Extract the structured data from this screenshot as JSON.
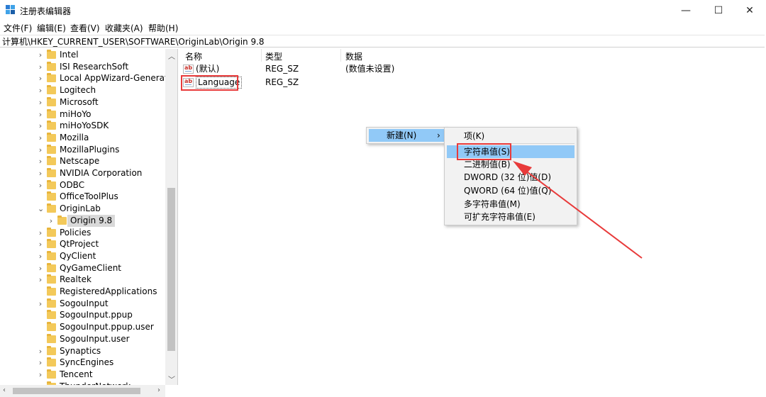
{
  "window": {
    "title": "注册表编辑器",
    "buttons": {
      "minimize": "—",
      "maximize": "☐",
      "close": "✕"
    },
    "icon": "registry-editor-icon"
  },
  "menubar": [
    "文件(F)",
    "编辑(E)",
    "查看(V)",
    "收藏夹(A)",
    "帮助(H)"
  ],
  "address": "计算机\\HKEY_CURRENT_USER\\SOFTWARE\\OriginLab\\Origin 9.8",
  "tree": {
    "items": [
      {
        "label": "Intel",
        "expander": true
      },
      {
        "label": "ISI ResearchSoft",
        "expander": true
      },
      {
        "label": "Local AppWizard-Generated Applications",
        "expander": true
      },
      {
        "label": "Logitech",
        "expander": true
      },
      {
        "label": "Microsoft",
        "expander": true
      },
      {
        "label": "miHoYo",
        "expander": true
      },
      {
        "label": "miHoYoSDK",
        "expander": true
      },
      {
        "label": "Mozilla",
        "expander": true
      },
      {
        "label": "MozillaPlugins",
        "expander": true
      },
      {
        "label": "Netscape",
        "expander": true
      },
      {
        "label": "NVIDIA Corporation",
        "expander": true
      },
      {
        "label": "ODBC",
        "expander": true
      },
      {
        "label": "OfficeToolPlus",
        "expander": false
      },
      {
        "label": "OriginLab",
        "expander": true,
        "expanded": true
      },
      {
        "label": "Origin 9.8",
        "expander": true,
        "child": true,
        "selected": true
      },
      {
        "label": "Policies",
        "expander": true
      },
      {
        "label": "QtProject",
        "expander": true
      },
      {
        "label": "QyClient",
        "expander": true
      },
      {
        "label": "QyGameClient",
        "expander": true
      },
      {
        "label": "Realtek",
        "expander": true
      },
      {
        "label": "RegisteredApplications",
        "expander": false
      },
      {
        "label": "SogouInput",
        "expander": true
      },
      {
        "label": "SogouInput.ppup",
        "expander": false
      },
      {
        "label": "SogouInput.ppup.user",
        "expander": false
      },
      {
        "label": "SogouInput.user",
        "expander": false
      },
      {
        "label": "Synaptics",
        "expander": true
      },
      {
        "label": "SyncEngines",
        "expander": true
      },
      {
        "label": "Tencent",
        "expander": true
      },
      {
        "label": "ThunderNetwork",
        "expander": true
      }
    ]
  },
  "values": {
    "columns": [
      "名称",
      "类型",
      "数据"
    ],
    "rows": [
      {
        "name": "(默认)",
        "type": "REG_SZ",
        "data": "(数值未设置)"
      },
      {
        "name": "Language",
        "type": "REG_SZ",
        "data": ""
      }
    ]
  },
  "context_menu": {
    "new_label": "新建(N)",
    "new_arrow": "›",
    "submenu": [
      "项(K)",
      "字符串值(S)",
      "二进制值(B)",
      "DWORD (32 位)值(D)",
      "QWORD (64 位)值(Q)",
      "多字符串值(M)",
      "可扩充字符串值(E)"
    ],
    "highlighted_index": 1
  },
  "colors": {
    "annotation_red": "#e83a3a",
    "menu_highlight": "#91c9f7",
    "folder": "#f3c95a"
  }
}
